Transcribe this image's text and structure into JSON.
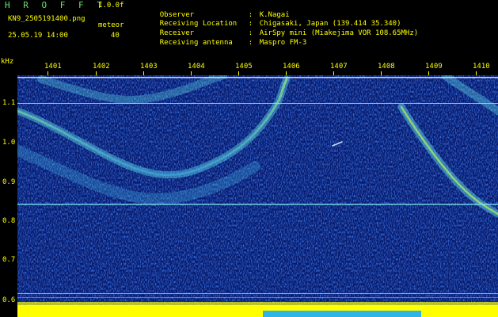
{
  "header": {
    "app_title": "HROFFT",
    "version": "1.0.0f",
    "filename": "KN9_2505191400.png",
    "mode_label": "meteor",
    "datetime": "25.05.19 14:00",
    "count": "40"
  },
  "meta": [
    {
      "key": "Observer",
      "sep": ":",
      "value": "K.Nagai"
    },
    {
      "key": "Receiving Location",
      "sep": ":",
      "value": "Chigasaki, Japan (139.414 35.340)"
    },
    {
      "key": "Receiver",
      "sep": ":",
      "value": "AirSpy mini (Miakejima VOR 108.65MHz)"
    },
    {
      "key": "Receiving antenna",
      "sep": ":",
      "value": "Maspro FM-3"
    }
  ],
  "axes": {
    "unit": "kHz",
    "y_ticks": [
      "1.1",
      "1.0",
      "0.9",
      "0.8",
      "0.7",
      "0.6"
    ],
    "x_ticks": [
      "1401",
      "1402",
      "1403",
      "1404",
      "1405",
      "1406",
      "1407",
      "1408",
      "1409",
      "1410"
    ]
  },
  "colors": {
    "background": "#000000",
    "text": "#ffff00",
    "title": "#6fe06f",
    "noise_dark": "#0a1a6e",
    "noise_mid": "#1f4fd6",
    "signal": "#42d7e8",
    "signal_hot": "#b6f05a"
  }
}
